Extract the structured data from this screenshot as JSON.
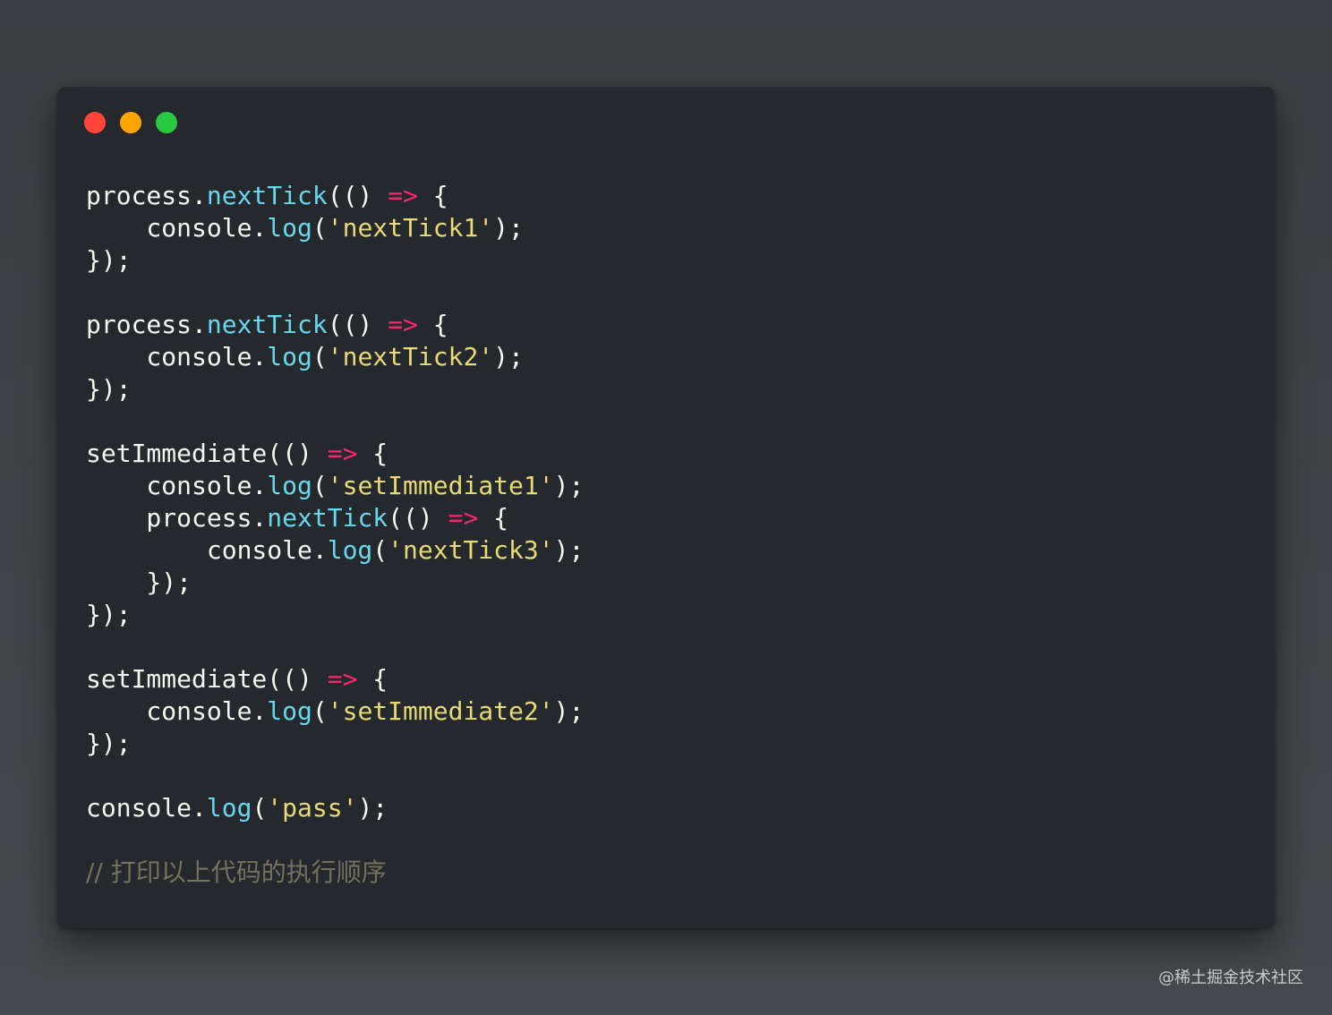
{
  "window": {
    "traffic_lights": [
      {
        "name": "close-dot",
        "color": "#ff453a"
      },
      {
        "name": "minimize-dot",
        "color": "#ffa500"
      },
      {
        "name": "zoom-dot",
        "color": "#28c840"
      }
    ]
  },
  "code": {
    "lines": [
      [
        {
          "t": "plain",
          "v": "process."
        },
        {
          "t": "method",
          "v": "nextTick"
        },
        {
          "t": "plain",
          "v": "(() "
        },
        {
          "t": "arrow",
          "v": "=>"
        },
        {
          "t": "plain",
          "v": " {"
        }
      ],
      [
        {
          "t": "plain",
          "v": "    console."
        },
        {
          "t": "method",
          "v": "log"
        },
        {
          "t": "plain",
          "v": "("
        },
        {
          "t": "string",
          "v": "'nextTick1'"
        },
        {
          "t": "plain",
          "v": ");"
        }
      ],
      [
        {
          "t": "plain",
          "v": "});"
        }
      ],
      [],
      [
        {
          "t": "plain",
          "v": "process."
        },
        {
          "t": "method",
          "v": "nextTick"
        },
        {
          "t": "plain",
          "v": "(() "
        },
        {
          "t": "arrow",
          "v": "=>"
        },
        {
          "t": "plain",
          "v": " {"
        }
      ],
      [
        {
          "t": "plain",
          "v": "    console."
        },
        {
          "t": "method",
          "v": "log"
        },
        {
          "t": "plain",
          "v": "("
        },
        {
          "t": "string",
          "v": "'nextTick2'"
        },
        {
          "t": "plain",
          "v": ");"
        }
      ],
      [
        {
          "t": "plain",
          "v": "});"
        }
      ],
      [],
      [
        {
          "t": "plain",
          "v": "setImmediate(() "
        },
        {
          "t": "arrow",
          "v": "=>"
        },
        {
          "t": "plain",
          "v": " {"
        }
      ],
      [
        {
          "t": "plain",
          "v": "    console."
        },
        {
          "t": "method",
          "v": "log"
        },
        {
          "t": "plain",
          "v": "("
        },
        {
          "t": "string",
          "v": "'setImmediate1'"
        },
        {
          "t": "plain",
          "v": ");"
        }
      ],
      [
        {
          "t": "plain",
          "v": "    process."
        },
        {
          "t": "method",
          "v": "nextTick"
        },
        {
          "t": "plain",
          "v": "(() "
        },
        {
          "t": "arrow",
          "v": "=>"
        },
        {
          "t": "plain",
          "v": " {"
        }
      ],
      [
        {
          "t": "plain",
          "v": "        console."
        },
        {
          "t": "method",
          "v": "log"
        },
        {
          "t": "plain",
          "v": "("
        },
        {
          "t": "string",
          "v": "'nextTick3'"
        },
        {
          "t": "plain",
          "v": ");"
        }
      ],
      [
        {
          "t": "plain",
          "v": "    });"
        }
      ],
      [
        {
          "t": "plain",
          "v": "});"
        }
      ],
      [],
      [
        {
          "t": "plain",
          "v": "setImmediate(() "
        },
        {
          "t": "arrow",
          "v": "=>"
        },
        {
          "t": "plain",
          "v": " {"
        }
      ],
      [
        {
          "t": "plain",
          "v": "    console."
        },
        {
          "t": "method",
          "v": "log"
        },
        {
          "t": "plain",
          "v": "("
        },
        {
          "t": "string",
          "v": "'setImmediate2'"
        },
        {
          "t": "plain",
          "v": ");"
        }
      ],
      [
        {
          "t": "plain",
          "v": "});"
        }
      ],
      [],
      [
        {
          "t": "plain",
          "v": "console."
        },
        {
          "t": "method",
          "v": "log"
        },
        {
          "t": "plain",
          "v": "("
        },
        {
          "t": "string",
          "v": "'pass'"
        },
        {
          "t": "plain",
          "v": ");"
        }
      ],
      [],
      [
        {
          "t": "comment",
          "v": "// 打印以上代码的执行顺序"
        }
      ]
    ]
  },
  "watermark": "@稀土掘金技术社区"
}
